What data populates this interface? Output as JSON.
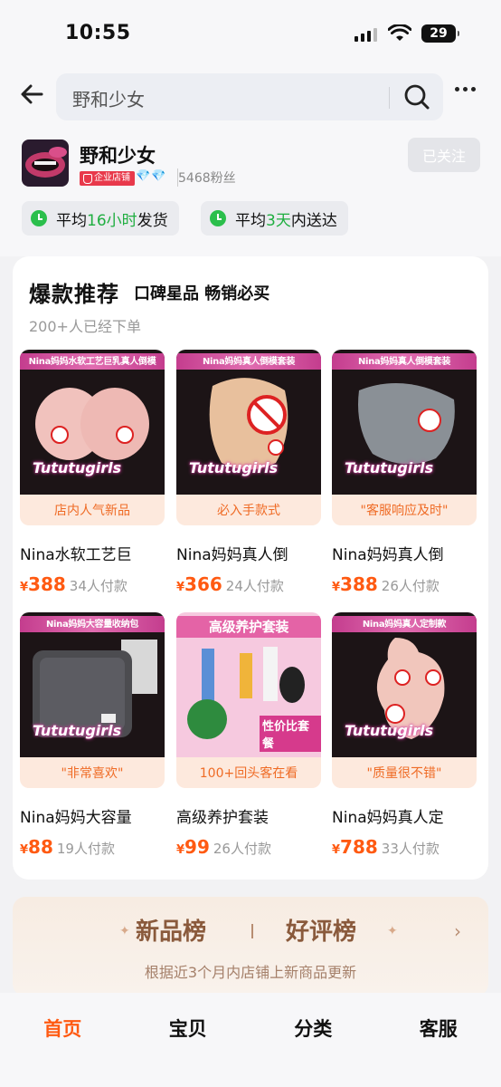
{
  "status_bar": {
    "time": "10:55",
    "battery": "29"
  },
  "search": {
    "query": "野和少女"
  },
  "shop": {
    "name": "野和少女",
    "badge": "企业店铺",
    "diamonds": "💎💎",
    "fans": "5468粉丝",
    "follow_label": "已关注",
    "ship_prefix": "平均",
    "ship_highlight": "16小时",
    "ship_suffix": "发货",
    "deliver_prefix": "平均",
    "deliver_highlight": "3天",
    "deliver_suffix": "内送达"
  },
  "recommend": {
    "title": "爆款推荐",
    "subtitle": "口碑星品 畅销必买",
    "count": "200+人已经下单",
    "currency": "¥",
    "items": [
      {
        "banner": "Nina妈妈水软工艺巨乳真人倒模",
        "brand": "Tututugirls",
        "tag": "店内人气新品",
        "name": "Nina水软工艺巨",
        "price": "388",
        "sold": "34人付款"
      },
      {
        "banner": "Nina妈妈真人倒模套装",
        "brand": "Tututugirls",
        "tag": "必入手款式",
        "name": "Nina妈妈真人倒",
        "price": "366",
        "sold": "24人付款"
      },
      {
        "banner": "Nina妈妈真人倒模套装",
        "brand": "Tututugirls",
        "tag": "\"客服响应及时\"",
        "name": "Nina妈妈真人倒",
        "price": "388",
        "sold": "26人付款"
      },
      {
        "banner": "Nina妈妈大容量收纳包",
        "brand": "Tututugirls",
        "tag": "\"非常喜欢\"",
        "name": "Nina妈妈大容量",
        "price": "88",
        "sold": "19人付款"
      },
      {
        "banner": "高级养护套装",
        "brand": "性价比套餐",
        "tag": "100+回头客在看",
        "name": "高级养护套装",
        "price": "99",
        "sold": "26人付款"
      },
      {
        "banner": "Nina妈妈真人定制款",
        "brand": "Tututugirls",
        "tag": "\"质量很不错\"",
        "name": "Nina妈妈真人定",
        "price": "788",
        "sold": "33人付款"
      }
    ]
  },
  "rank": {
    "new": "新品榜",
    "good": "好评榜",
    "desc": "根据近3个月内店铺上新商品更新"
  },
  "nav": {
    "tabs": [
      "首页",
      "宝贝",
      "分类",
      "客服"
    ]
  },
  "colors": {
    "accent": "#ff5a12",
    "green": "#1fae40"
  }
}
